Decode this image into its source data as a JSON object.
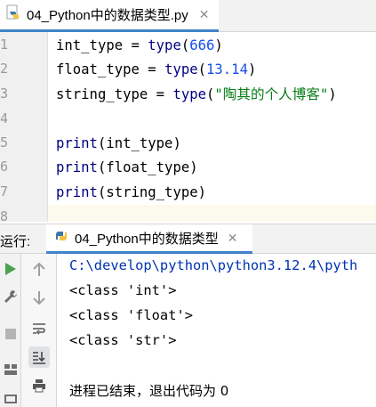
{
  "editor_tab": {
    "title": "04_Python中的数据类型.py",
    "close": "✕"
  },
  "editor": {
    "line_numbers": [
      "1",
      "2",
      "3",
      "4",
      "5",
      "6",
      "7",
      "8"
    ],
    "lines": [
      {
        "var": "int_type",
        "op": " = ",
        "fn": "type",
        "open": "(",
        "arg": "666",
        "close": ")"
      },
      {
        "var": "float_type",
        "op": " = ",
        "fn": "type",
        "open": "(",
        "arg": "13.14",
        "close": ")"
      },
      {
        "var": "string_type",
        "op": " = ",
        "fn": "type",
        "open": "(",
        "arg": "\"陶其的个人博客\"",
        "close": ")"
      },
      {
        "fn": "print",
        "open": "(",
        "arg": "int_type",
        "close": ")"
      },
      {
        "fn": "print",
        "open": "(",
        "arg": "float_type",
        "close": ")"
      },
      {
        "fn": "print",
        "open": "(",
        "arg": "string_type",
        "close": ")"
      }
    ]
  },
  "run_panel": {
    "label": "运行:",
    "tab_title": "04_Python中的数据类型",
    "tab_close": "✕"
  },
  "console": {
    "command": "C:\\develop\\python\\python3.12.4\\pyth",
    "outputs": [
      "<class 'int'>",
      "<class 'float'>",
      "<class 'str'>"
    ],
    "exit_message": "进程已结束，退出代码为 0"
  },
  "colors": {
    "accent": "#4083c9",
    "run_green": "#4ca24c",
    "number": "#1750eb",
    "string": "#067d17",
    "keyword_fn": "#000080"
  }
}
